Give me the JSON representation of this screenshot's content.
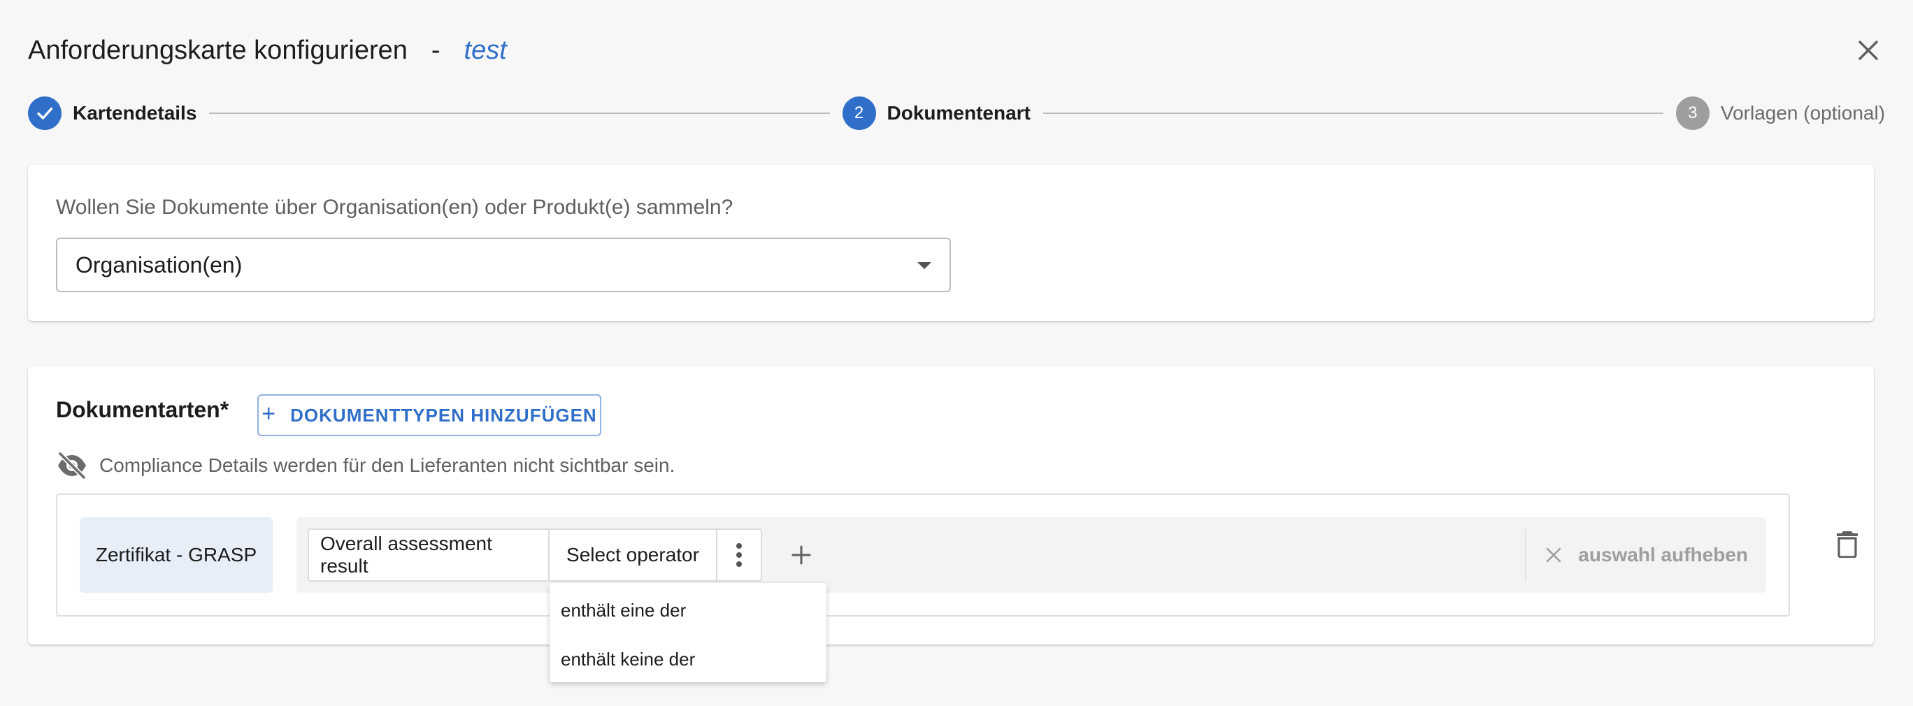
{
  "header": {
    "title": "Anforderungskarte konfigurieren",
    "separator": "-",
    "card_name": "test",
    "close_icon": "close-icon"
  },
  "stepper": {
    "steps": [
      {
        "number": "1",
        "label": "Kartendetails",
        "state": "completed",
        "icon": "check-icon"
      },
      {
        "number": "2",
        "label": "Dokumentenart",
        "state": "active"
      },
      {
        "number": "3",
        "label": "Vorlagen (optional)",
        "state": "inactive"
      }
    ]
  },
  "collection": {
    "question": "Wollen Sie Dokumente über Organisation(en) oder Produkt(e) sammeln?",
    "selected": "Organisation(en)"
  },
  "document_types": {
    "title": "Dokumentarten*",
    "add_button": "DOKUMENTTYPEN HINZUFÜGEN",
    "visibility_note": "Compliance Details werden für den Lieferanten nicht sichtbar sein.",
    "rows": [
      {
        "document": "Zertifikat - GRASP",
        "attribute": "Overall assessment result",
        "operator_placeholder": "Select operator",
        "clear_label": "auswahl aufheben"
      }
    ]
  },
  "operator_menu": {
    "options": [
      "enthält eine der",
      "enthält keine der"
    ]
  },
  "colors": {
    "accent": "#2f6fc9",
    "inactive_step": "#9e9e9e",
    "chip_bg": "#e8eef8"
  }
}
